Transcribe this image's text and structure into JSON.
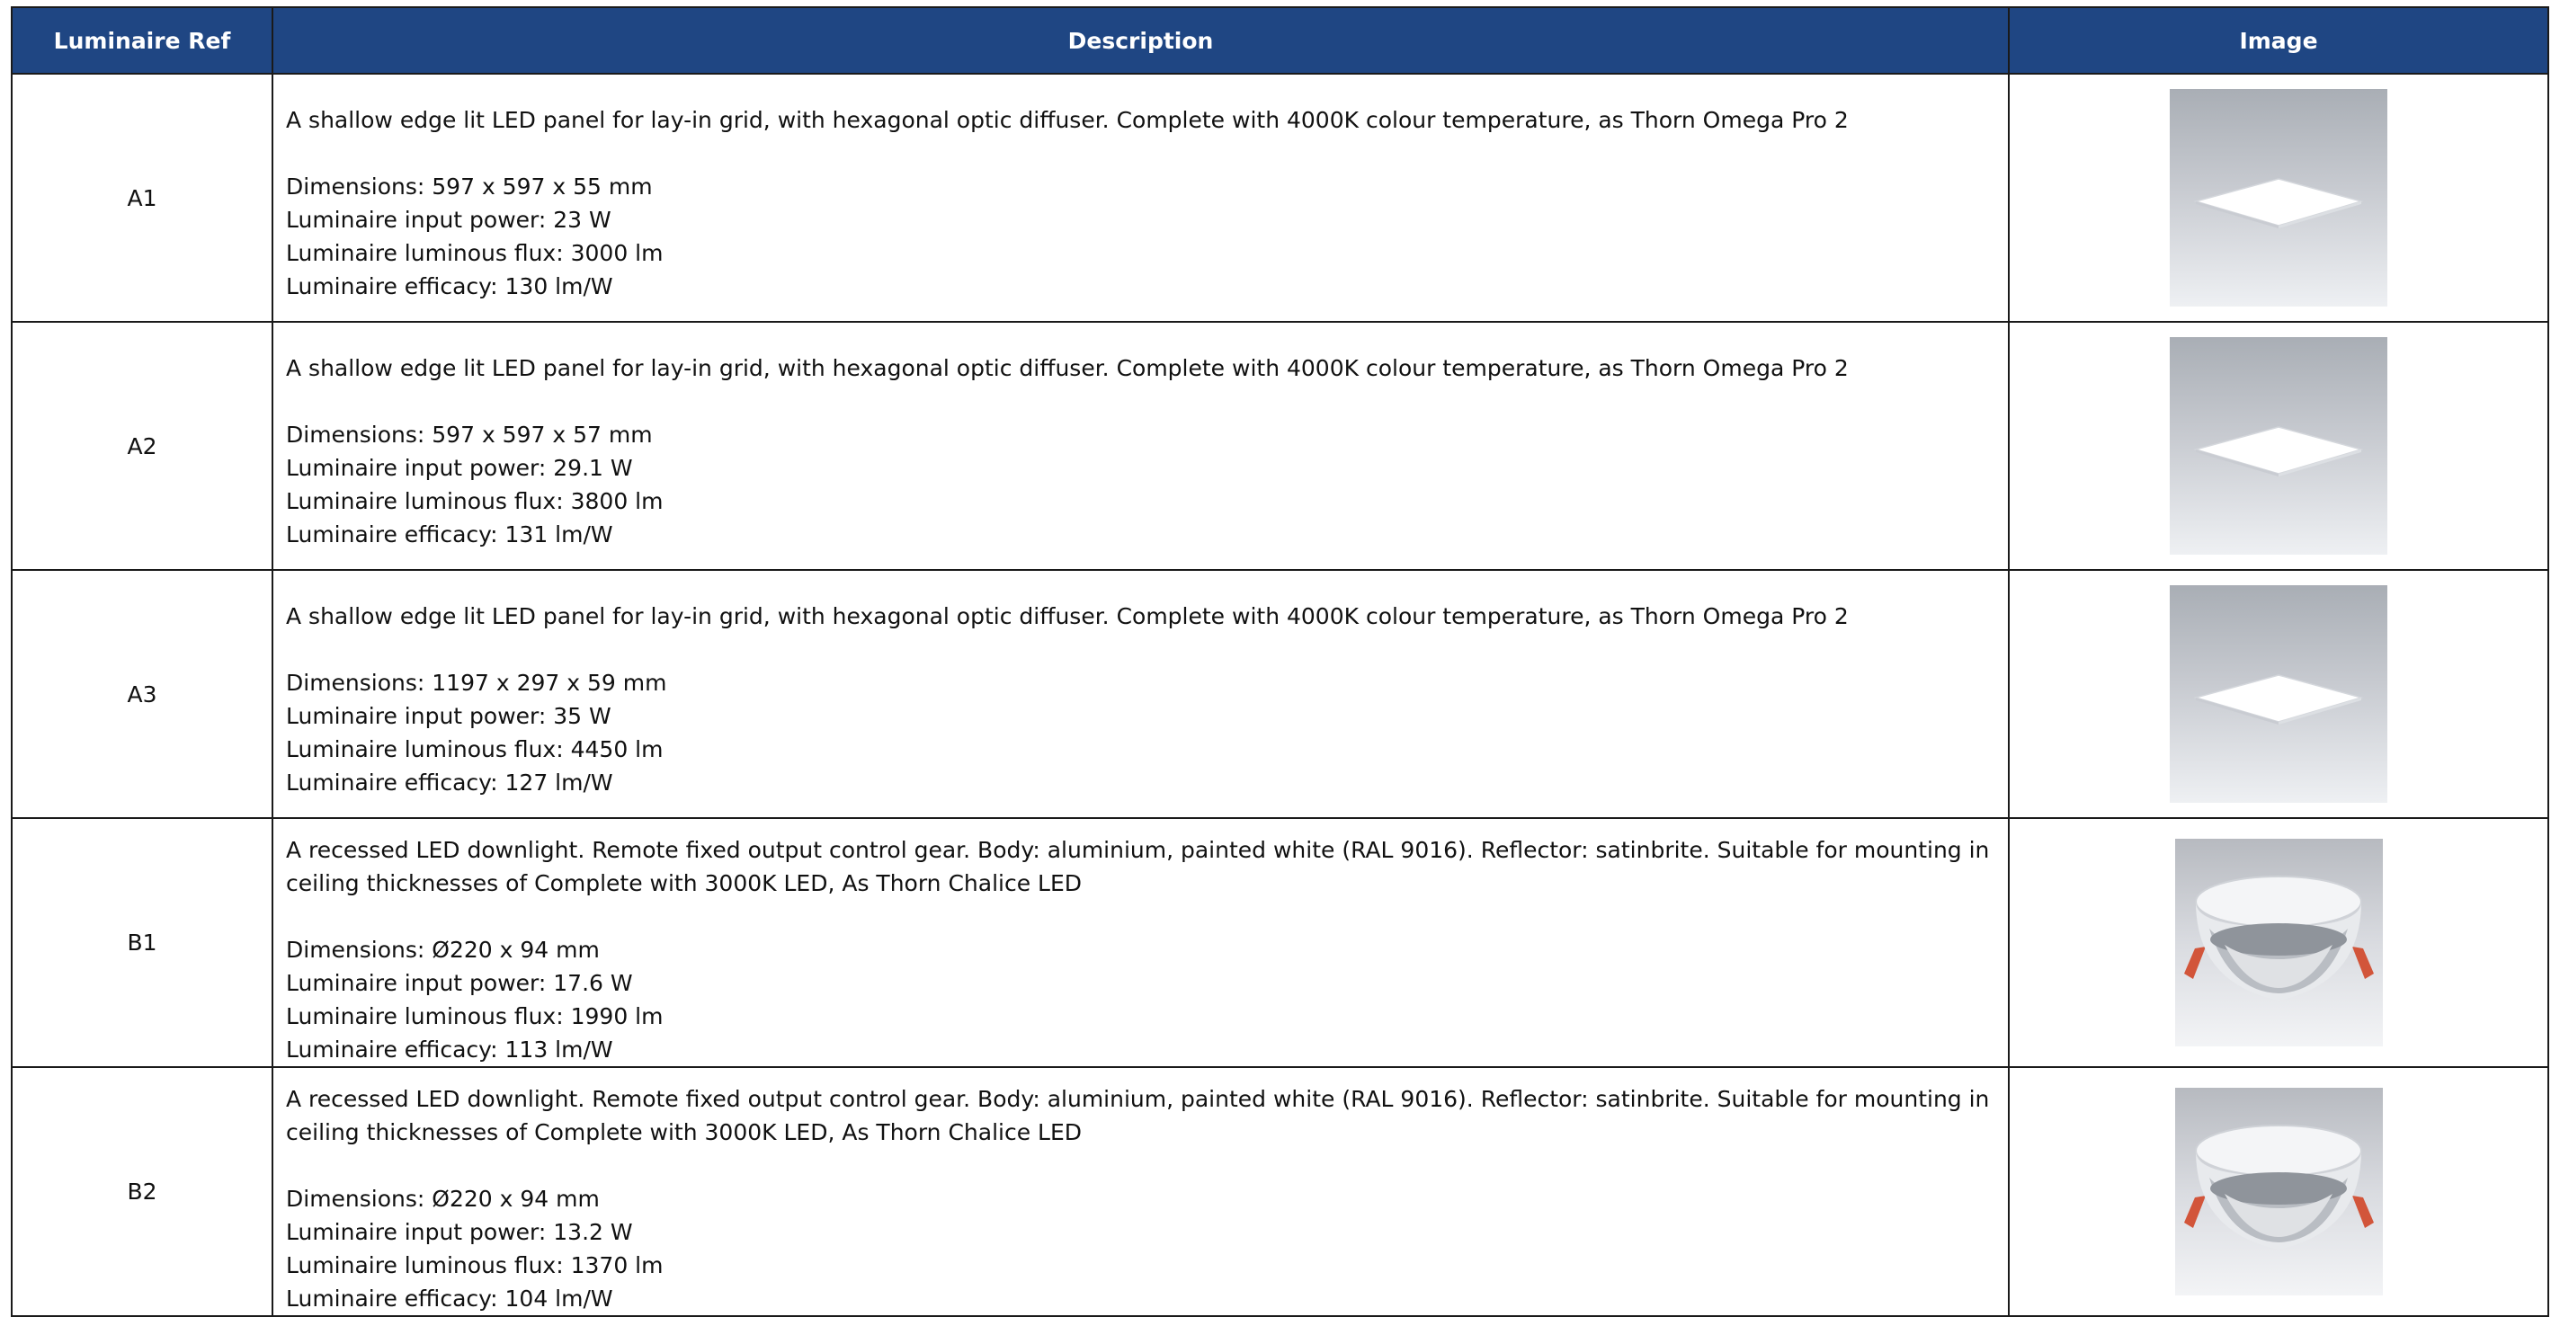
{
  "table": {
    "headers": [
      "Luminaire Ref",
      "Description",
      "Image"
    ],
    "rows": [
      {
        "ref": "A1",
        "description": "A shallow edge lit LED panel for lay-in grid, with hexagonal optic diffuser. Complete with 4000K colour temperature, as Thorn Omega Pro 2",
        "specs": [
          "Dimensions: 597 x 597 x 55 mm",
          "Luminaire input power: 23 W",
          "Luminaire luminous flux: 3000 lm",
          "Luminaire efficacy: 130 lm/W"
        ],
        "image_icon": "panel-light-icon"
      },
      {
        "ref": "A2",
        "description": "A shallow edge lit LED panel for lay-in grid, with hexagonal optic diffuser. Complete with 4000K colour temperature, as Thorn Omega Pro 2",
        "specs": [
          "Dimensions: 597 x 597 x 57 mm",
          "Luminaire input power: 29.1 W",
          "Luminaire luminous flux: 3800 lm",
          "Luminaire efficacy: 131 lm/W"
        ],
        "image_icon": "panel-light-icon"
      },
      {
        "ref": "A3",
        "description": "A shallow edge lit LED panel for lay-in grid, with hexagonal optic diffuser. Complete with 4000K colour temperature, as Thorn Omega Pro 2",
        "specs": [
          "Dimensions: 1197 x 297 x 59 mm",
          "Luminaire input power: 35 W",
          "Luminaire luminous flux: 4450 lm",
          "Luminaire efficacy: 127 lm/W"
        ],
        "image_icon": "panel-light-icon"
      },
      {
        "ref": "B1",
        "description": "A recessed LED downlight. Remote fixed output control gear. Body: aluminium, painted white (RAL 9016). Reflector: satinbrite. Suitable for mounting in ceiling thicknesses of Complete with 3000K LED, As Thorn Chalice LED",
        "specs": [
          "Dimensions: Ø220 x 94 mm",
          "Luminaire input power: 17.6 W",
          "Luminaire luminous flux: 1990 lm",
          "Luminaire efficacy: 113 lm/W"
        ],
        "image_icon": "downlight-icon"
      },
      {
        "ref": "B2",
        "description": "A recessed LED downlight. Remote fixed output control gear. Body: aluminium, painted white (RAL 9016). Reflector: satinbrite. Suitable for mounting in ceiling thicknesses of Complete with 3000K LED, As Thorn Chalice LED",
        "specs": [
          "Dimensions: Ø220 x 94 mm",
          "Luminaire input power: 13.2 W",
          "Luminaire luminous flux: 1370 lm",
          "Luminaire efficacy: 104 lm/W"
        ],
        "image_icon": "downlight-icon"
      }
    ]
  },
  "colors": {
    "header_bg": "#1f4683",
    "header_text": "#ffffff",
    "border": "#1a1a1a"
  }
}
